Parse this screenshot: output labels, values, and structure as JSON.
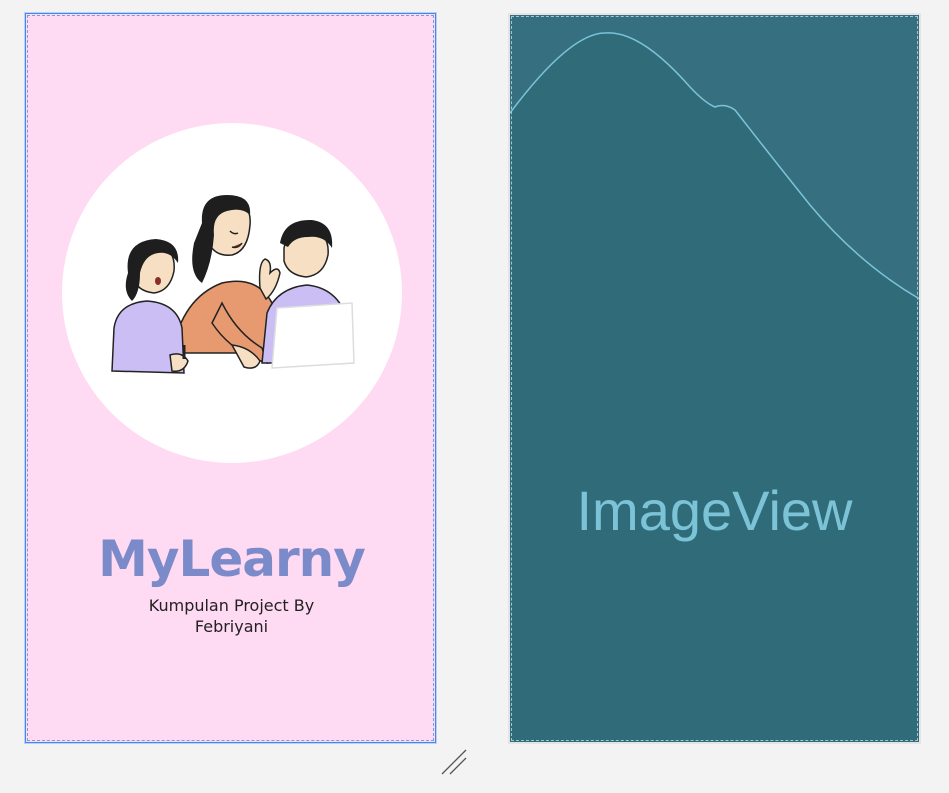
{
  "design_preview": {
    "title": "MyLearny",
    "subtitle_line1": "Kumpulan Project By",
    "subtitle_line2": "Febriyani",
    "background_color": "#ffdaf3",
    "title_color": "#7b8ac8",
    "illustration": "people-studying-illustration"
  },
  "blueprint_preview": {
    "placeholder_label": "ImageView",
    "background_color": "#2f6b79",
    "label_color": "#7cc3d8"
  },
  "canvas": {
    "resize_handle": "resize-handle-icon"
  }
}
